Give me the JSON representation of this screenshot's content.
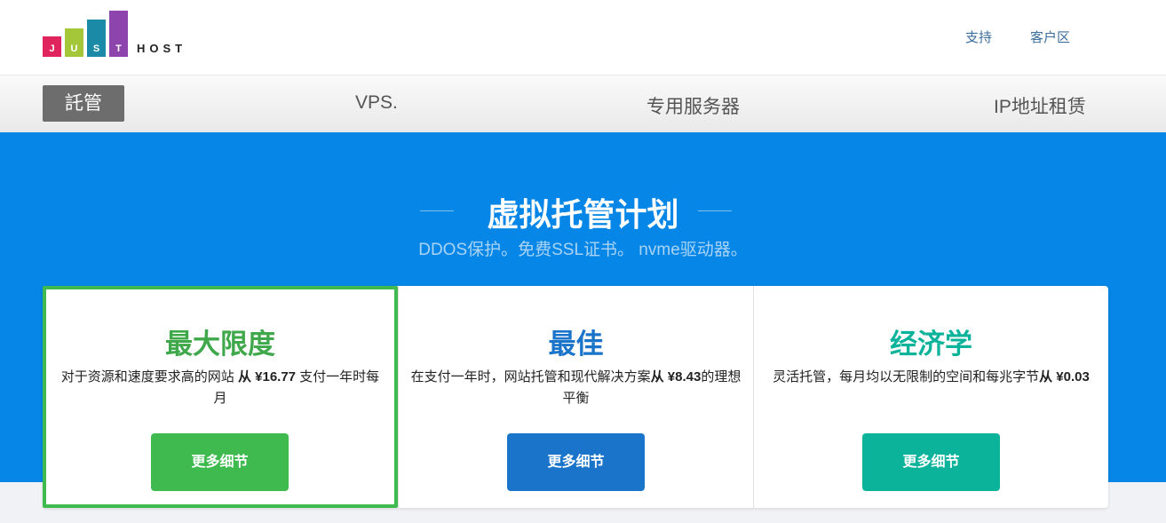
{
  "logo": {
    "letters": [
      "J",
      "U",
      "S",
      "T"
    ],
    "word": "HOST",
    "colors": [
      "#e0245e",
      "#a4c639",
      "#1b8aa6",
      "#8e44ad"
    ]
  },
  "top_links": [
    "支持",
    "客户区"
  ],
  "nav": {
    "active": "託管",
    "items": [
      "VPS.",
      "专用服务器",
      "IP地址租赁"
    ]
  },
  "hero": {
    "title": "虚拟托管计划",
    "subtitle": "DDOS保护。免费SSL证书。 nvme驱动器。"
  },
  "plans": [
    {
      "name": "最大限度",
      "desc_before": "对于资源和速度要求高的网站 ",
      "price": "从 ¥16.77",
      "desc_after": " 支付一年时每月",
      "button": "更多细节",
      "color": "#3fba4f",
      "selected": true
    },
    {
      "name": "最佳",
      "desc_before": "在支付一年时，网站托管和现代解决方案",
      "price": "从 ¥8.43",
      "desc_after": "的理想平衡",
      "button": "更多细节",
      "color": "#1a74c9",
      "selected": false
    },
    {
      "name": "经济学",
      "desc_before": "灵活托管，每月均以无限制的空间和每兆字节",
      "price": "从 ¥0.03",
      "desc_after": "",
      "button": "更多细节",
      "color": "#0bb39b",
      "selected": false
    }
  ]
}
